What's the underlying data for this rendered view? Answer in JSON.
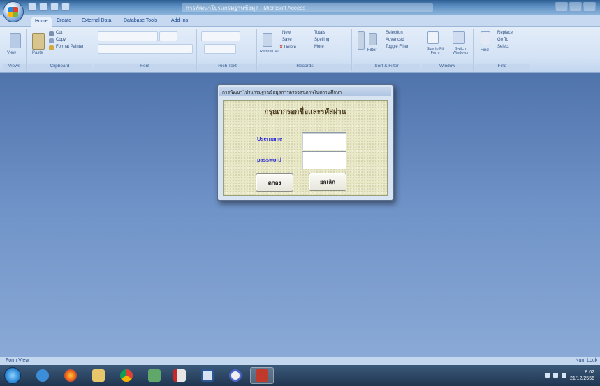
{
  "window": {
    "title": "การพัฒนาโปรแกรมฐานข้อมูล - Microsoft Access"
  },
  "ribbon": {
    "tabs": [
      "Home",
      "Create",
      "External Data",
      "Database Tools",
      "Add-Ins"
    ],
    "groups": [
      {
        "label": "Views"
      },
      {
        "label": "Clipboard"
      },
      {
        "label": "Font"
      },
      {
        "label": "Rich Text"
      },
      {
        "label": "Records"
      },
      {
        "label": "Sort & Filter"
      },
      {
        "label": "Window"
      },
      {
        "label": "Find"
      }
    ],
    "clipboard": {
      "cut": "Cut",
      "copy": "Copy",
      "format_painter": "Format Painter"
    },
    "records": {
      "new": "New",
      "save": "Save",
      "delete": "Delete",
      "totals": "Totals",
      "spelling": "Spelling",
      "more": "More"
    },
    "sort_filter": {
      "filter": "Filter",
      "selection": "Selection",
      "advanced": "Advanced",
      "toggle_filter": "Toggle Filter"
    },
    "window": {
      "size_to_fit": "Size to Fit Form",
      "switch_windows": "Switch Windows"
    },
    "find": {
      "find": "Find",
      "replace": "Replace",
      "goto": "Go To",
      "select": "Select"
    },
    "views": {
      "view": "View"
    },
    "paste": "Paste",
    "refresh_all": "Refresh All"
  },
  "dialog": {
    "title": "การพัฒนาโปรแกรมฐานข้อมูลการตรวจสุขภาพในสถานศึกษา",
    "heading": "กรุณากรอกชื่อและรหัสผ่าน",
    "username_label": "Username",
    "password_label": "password",
    "username_value": "",
    "password_value": "",
    "ok_button": "ตกลง",
    "cancel_button": "ยกเลิก"
  },
  "statusbar": {
    "left": "Form View",
    "right": "Num Lock"
  },
  "taskbar": {
    "time": "8:02",
    "date": "21/12/2556"
  },
  "colors": {
    "workspace": "#6e92c7",
    "dialog_body": "#e8e8c6",
    "label_blue": "#2b2bd6"
  }
}
